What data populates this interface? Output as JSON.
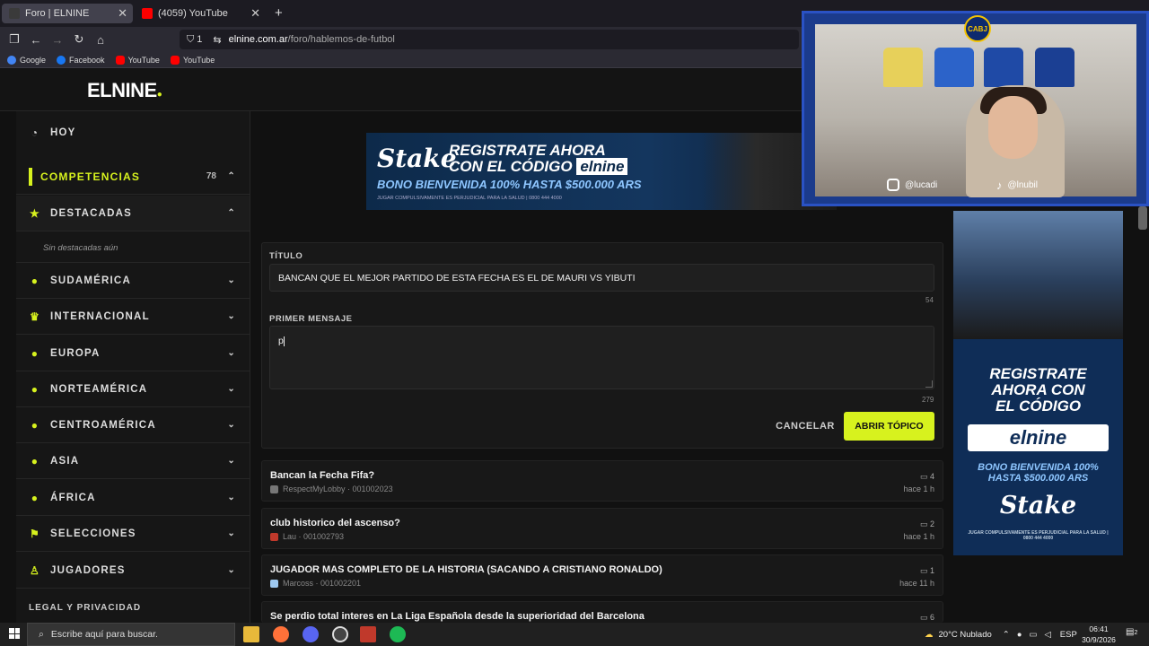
{
  "browser": {
    "tabs": [
      {
        "label": "Foro | ELNINE",
        "active": true,
        "favicon_color": "#3a3a3a"
      },
      {
        "label": "(4059) YouTube",
        "active": false,
        "favicon_color": "#ff0000"
      }
    ],
    "new_tab_glyph": "+",
    "shield_count": "1",
    "url_domain": "elnine.com.ar",
    "url_path": "/foro/hablemos-de-futbol",
    "bookmarks": [
      {
        "label": "Google",
        "color": "#4285f4"
      },
      {
        "label": "Facebook",
        "color": "#1877f2"
      },
      {
        "label": "YouTube",
        "color": "#ff0000"
      },
      {
        "label": "YouTube",
        "color": "#ff0000"
      }
    ]
  },
  "site": {
    "logo": "ELNINE",
    "accent": "#d7f21e"
  },
  "sidebar": {
    "items": [
      {
        "label": "HOY",
        "icon": "clock-icon",
        "glyph": "◔",
        "expanded": false
      },
      {
        "label": "COMPETENCIAS",
        "icon": "bar-icon",
        "count": "78",
        "chev": "⌃"
      },
      {
        "label": "DESTACADAS",
        "icon": "star-icon",
        "glyph": "★",
        "chev": "⌃"
      },
      {
        "label": "SUDAMÉRICA",
        "icon": "south-america-icon",
        "glyph": "●",
        "chev": "⌄"
      },
      {
        "label": "INTERNACIONAL",
        "icon": "trophy-icon",
        "glyph": "♛",
        "chev": "⌄"
      },
      {
        "label": "EUROPA",
        "icon": "europe-icon",
        "glyph": "●",
        "chev": "⌄"
      },
      {
        "label": "NORTEAMÉRICA",
        "icon": "north-america-icon",
        "glyph": "●",
        "chev": "⌄"
      },
      {
        "label": "CENTROAMÉRICA",
        "icon": "central-america-icon",
        "glyph": "●",
        "chev": "⌄"
      },
      {
        "label": "ASIA",
        "icon": "asia-icon",
        "glyph": "●",
        "chev": "⌄"
      },
      {
        "label": "ÁFRICA",
        "icon": "africa-icon",
        "glyph": "●",
        "chev": "⌄"
      },
      {
        "label": "SELECCIONES",
        "icon": "flag-icon",
        "glyph": "⚑",
        "chev": "⌄"
      },
      {
        "label": "JUGADORES",
        "icon": "user-icon",
        "glyph": "♙",
        "chev": "⌄"
      }
    ],
    "empty_featured": "Sin destacadas aún",
    "legal": "LEGAL Y PRIVACIDAD"
  },
  "banner": {
    "brand": "Stake",
    "line1": "REGISTRATE AHORA",
    "line2_prefix": "CON EL CÓDIGO",
    "code": "elnine",
    "bonus": "BONO BIENVENIDA 100% HASTA $500.000 ARS",
    "legal": "JUGAR COMPULSIVAMENTE ES PERJUDICIAL PARA LA SALUD | 0800 444 4000"
  },
  "form": {
    "title_label": "TÍTULO",
    "title_value": "BANCAN QUE EL MEJOR PARTIDO DE ESTA FECHA ES EL DE MAURI VS YIBUTI",
    "title_remaining": "54",
    "message_label": "PRIMER MENSAJE",
    "message_value": "p",
    "message_remaining": "279",
    "cancel_label": "CANCELAR",
    "submit_label": "ABRIR TÓPICO"
  },
  "topics": [
    {
      "title": "Bancan la Fecha Fifa?",
      "author": "RespectMyLobby · 001002023",
      "replies": "4",
      "time": "hace 1 h",
      "avatar_color": "#777"
    },
    {
      "title": "club historico del ascenso?",
      "author": "Lau · 001002793",
      "replies": "2",
      "time": "hace 1 h",
      "avatar_color": "#c0392b"
    },
    {
      "title": "JUGADOR MAS COMPLETO DE LA HISTORIA (SACANDO A CRISTIANO RONALDO)",
      "author": "Marcoss · 001002201",
      "replies": "1",
      "time": "hace 11 h",
      "avatar_color": "#9ec9f0"
    },
    {
      "title": "Se perdio total interes en La Liga Española desde la superioridad del Barcelona",
      "author": "",
      "replies": "6",
      "time": "",
      "avatar_color": "#777"
    }
  ],
  "right_ad": {
    "line1": "REGISTRATE",
    "line2": "AHORA CON",
    "line3": "EL CÓDIGO",
    "code": "elnine",
    "bonus1": "BONO BIENVENIDA 100%",
    "bonus2": "HASTA $500.000 ARS",
    "brand": "Stake",
    "legal": "JUGAR COMPULSIVAMENTE ES PERJUDICIAL PARA LA SALUD | 0800 444 4000"
  },
  "webcam": {
    "badge": "CABJ",
    "ig_handle": "@lucadi",
    "tiktok_handle": "@lnubil"
  },
  "taskbar": {
    "search_placeholder": "Escribe aquí para buscar.",
    "weather": "20°C  Nublado",
    "lang": "ESP",
    "time": "06:41",
    "date": "30/9/2026",
    "notif": "2"
  }
}
